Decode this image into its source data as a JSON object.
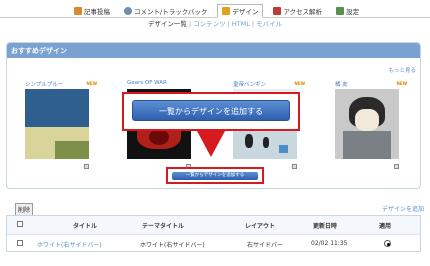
{
  "nav": {
    "items": [
      {
        "label": "記事投稿",
        "color": "#d98b2b"
      },
      {
        "label": "コメント/トラックバック",
        "color": "#6d8fb0"
      },
      {
        "label": "デザイン",
        "color": "#e0a020"
      },
      {
        "label": "アクセス解析",
        "color": "#c03a3a"
      },
      {
        "label": "設定",
        "color": "#5a8f4d"
      }
    ],
    "sub": [
      "デザイン一覧",
      "コンテンツ",
      "HTML",
      "モバイル"
    ]
  },
  "recommended": {
    "title": "おすすめデザイン",
    "more": "もっと見る",
    "badge": "NEW",
    "cards": [
      {
        "name": "シンプルブルー"
      },
      {
        "name": "Gears OF WAR"
      },
      {
        "name": "皇帝ペンギン"
      },
      {
        "name": "橘 友"
      }
    ]
  },
  "add_button_large": "一覧からデザインを追加する",
  "add_button_small": "一覧からデザインを追加する",
  "table": {
    "delete": "削除",
    "add_link": "デザインを追加",
    "headers": [
      "タイトル",
      "テーマタイトル",
      "レイアウト",
      "更新日時",
      "適用"
    ],
    "rows": [
      {
        "title": "ホワイト(右サイドバー)",
        "theme": "ホワイト(右サイドバー)",
        "layout": "右サイドバー",
        "updated": "02/02 11:35"
      }
    ]
  }
}
